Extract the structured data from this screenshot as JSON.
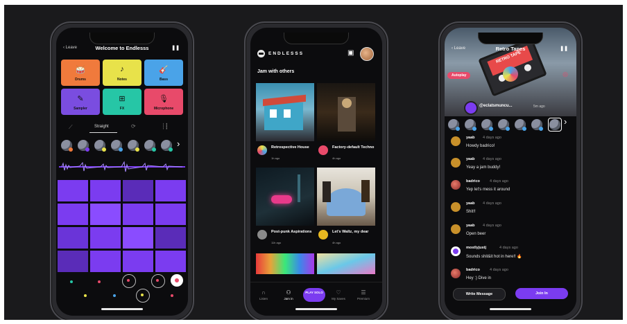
{
  "colors": {
    "purple": "#7b3cf0",
    "orange": "#f07a3c",
    "yellow": "#e8e24a",
    "blue": "#4aa3e8",
    "violet": "#7a4de0",
    "teal": "#26c6a6",
    "pink": "#e84a6a"
  },
  "phone1": {
    "back_label": "Leave",
    "title": "Welcome to Endlesss",
    "pause_icon": "pause-icon",
    "instruments": [
      {
        "label": "Drums",
        "icon": "drum-icon"
      },
      {
        "label": "Notes",
        "icon": "note-icon"
      },
      {
        "label": "Bass",
        "icon": "guitar-icon"
      },
      {
        "label": "Sampler",
        "icon": "pen-icon"
      },
      {
        "label": "FX",
        "icon": "grid-icon"
      },
      {
        "label": "Microphone",
        "icon": "mic-icon"
      }
    ],
    "mode_label": "Straight"
  },
  "phone2": {
    "brand": "ENDLESSS",
    "section_title": "Jam with others",
    "cards": [
      {
        "title": "Retrospective House",
        "time": "1h ago"
      },
      {
        "title": "Factory-default Techno",
        "time": "4h ago"
      },
      {
        "title": "Post-punk Aspirations",
        "time": "11h ago"
      },
      {
        "title": "Let's Waltz, my dear",
        "time": "4h ago"
      }
    ],
    "tabs": [
      {
        "label": "Listen",
        "icon": "headphones-icon"
      },
      {
        "label": "Jam in",
        "icon": "jam-icon"
      },
      {
        "label": "PLAY SOLO",
        "icon": "play-icon"
      },
      {
        "label": "My Saves",
        "icon": "heart-icon"
      },
      {
        "label": "Premium",
        "icon": "premium-icon"
      }
    ]
  },
  "phone3": {
    "back_label": "Leave",
    "title": "Retro Tapes",
    "badge": "Autoplay",
    "cassette_label": "RETRO TAPE",
    "user_handle": "@eclatsmuncu...",
    "user_time": "5m ago",
    "messages": [
      {
        "name": "yaab",
        "time": "4 days ago",
        "text": "Howdy badrico!"
      },
      {
        "name": "yaab",
        "time": "4 days ago",
        "text": "Yeay a jam buddy!"
      },
      {
        "name": "badrico",
        "time": "4 days ago",
        "text": "Yep let's mess it around"
      },
      {
        "name": "yaab",
        "time": "4 days ago",
        "text": "Shit!!"
      },
      {
        "name": "yaab",
        "time": "4 days ago",
        "text": "Open beer"
      },
      {
        "name": "mostlyjustj",
        "time": "4 days ago",
        "text": "Sounds shit&it hot in here!! 🔥"
      },
      {
        "name": "badrico",
        "time": "4 days ago",
        "text": "Hey :) Dive in"
      }
    ],
    "write_button": "Write Message",
    "join_button": "Join In"
  }
}
